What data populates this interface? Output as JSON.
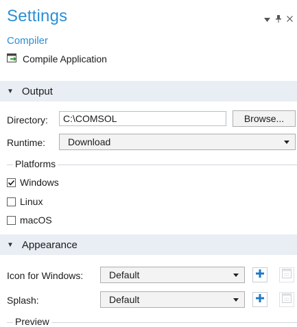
{
  "panel": {
    "title": "Settings",
    "subtitle": "Compiler",
    "compile_label": "Compile Application"
  },
  "output": {
    "header": "Output",
    "directory_label": "Directory:",
    "directory_value": "C:\\COMSOL",
    "browse_label": "Browse...",
    "runtime_label": "Runtime:",
    "runtime_value": "Download",
    "platforms_label": "Platforms",
    "platforms": [
      {
        "label": "Windows",
        "checked": true
      },
      {
        "label": "Linux",
        "checked": false
      },
      {
        "label": "macOS",
        "checked": false
      }
    ]
  },
  "appearance": {
    "header": "Appearance",
    "icon_label": "Icon for Windows:",
    "icon_value": "Default",
    "splash_label": "Splash:",
    "splash_value": "Default",
    "preview_label": "Preview"
  },
  "colors": {
    "accent": "#2a8fd4",
    "section_bg": "#e9eef4",
    "add_icon": "#1f78c8"
  },
  "icons": {
    "window_menu": "chevron-down-icon",
    "pin": "pin-icon",
    "close": "close-icon",
    "compile": "compile-icon",
    "add": "plus-icon",
    "image": "image-icon"
  }
}
